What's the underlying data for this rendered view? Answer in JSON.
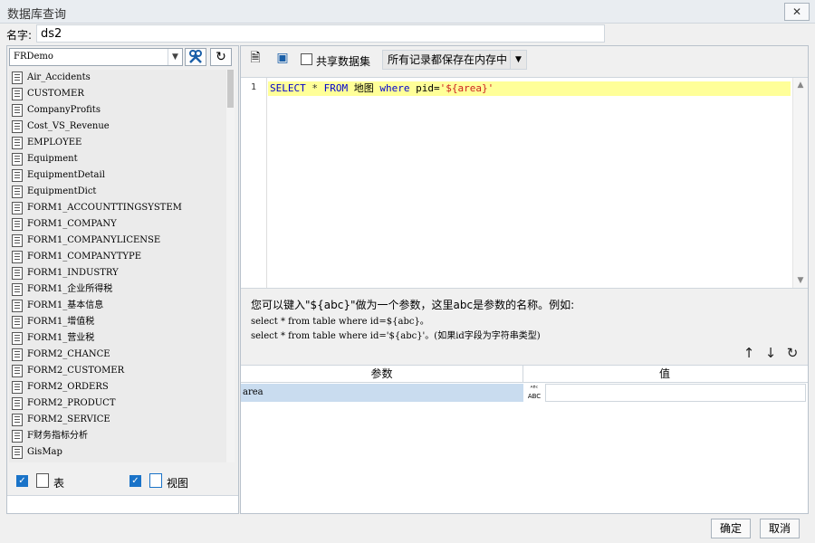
{
  "window": {
    "title": "数据库查询",
    "close_symbol": "✕"
  },
  "name_row": {
    "label": "名字:",
    "value": "ds2"
  },
  "left": {
    "connection": "FRDemo",
    "tables": [
      "Air_Accidents",
      "CUSTOMER",
      "CompanyProfits",
      "Cost_VS_Revenue",
      "EMPLOYEE",
      "Equipment",
      "EquipmentDetail",
      "EquipmentDict",
      "FORM1_ACCOUNTTINGSYSTEM",
      "FORM1_COMPANY",
      "FORM1_COMPANYLICENSE",
      "FORM1_COMPANYTYPE",
      "FORM1_INDUSTRY",
      "FORM1_企业所得税",
      "FORM1_基本信息",
      "FORM1_增值税",
      "FORM1_营业税",
      "FORM2_CHANCE",
      "FORM2_CUSTOMER",
      "FORM2_ORDERS",
      "FORM2_PRODUCT",
      "FORM2_SERVICE",
      "F财务指标分析",
      "GisMap"
    ],
    "filter_table_label": "表",
    "filter_view_label": "视图"
  },
  "right": {
    "share_label": "共享数据集",
    "record_mode": "所有记录都保存在内存中",
    "sql": {
      "line_no": "1",
      "kw_select": "SELECT",
      "star": " * ",
      "kw_from": "FROM",
      "table": " 地图 ",
      "kw_where": "where",
      "cond": " pid=",
      "str": "'${area}'"
    },
    "hint_1": "您可以键入\"${abc}\"做为一个参数，这里abc是参数的名称。例如:",
    "hint_2": "select * from table where id=${abc}。",
    "hint_3": "select * from table where id='${abc}'。(如果id字段为字符串类型)",
    "param_header_name": "参数",
    "param_header_value": "值",
    "params": [
      {
        "name": "area",
        "type_line1": "ᴬᴮᶜ",
        "type_line2": "ABC",
        "value": ""
      }
    ]
  },
  "buttons": {
    "ok": "确定",
    "cancel": "取消"
  }
}
